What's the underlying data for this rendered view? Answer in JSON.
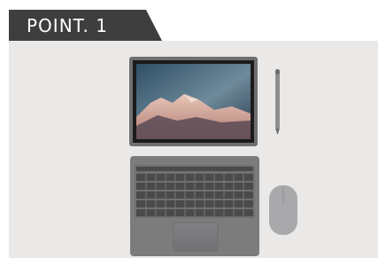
{
  "header": {
    "label": "POINT. 1"
  },
  "photo": {
    "subject": "laptop-keyboard-pen-mouse-product-photo",
    "colors": {
      "background": "#eae9e8",
      "tab": "#3e3e3e",
      "device_body": "#6f6f70",
      "screen_frame": "#1b1b1c",
      "keyboard": "#7d7c7c",
      "keys": "#4a4a4b",
      "mouse": "#a9a9ab",
      "pen": "#8e8e90"
    }
  }
}
